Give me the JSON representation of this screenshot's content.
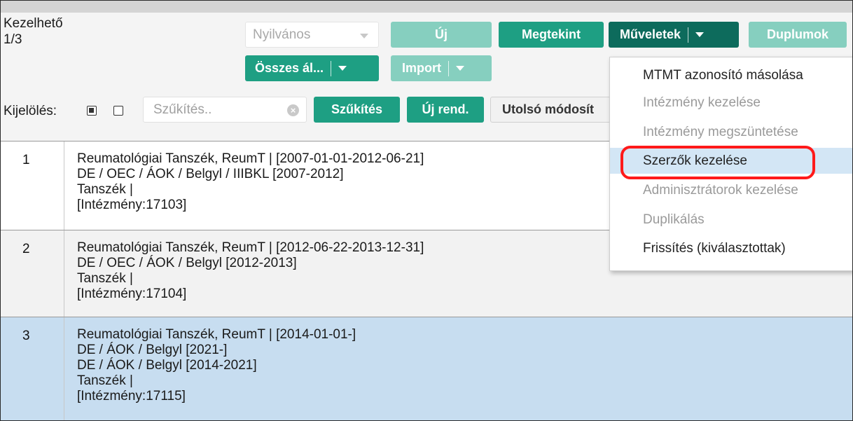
{
  "status": {
    "label": "Kezelhető",
    "count": "1/3"
  },
  "visibility_select": {
    "value": "Nyilvános"
  },
  "toolbar": {
    "new": "Új",
    "view": "Megtekint",
    "actions": "Műveletek",
    "duplicates": "Duplumok",
    "all_status": "Összes ál...",
    "import": "Import"
  },
  "selection": {
    "label": "Kijelölés:"
  },
  "filter": {
    "placeholder": "Szűkítés..",
    "button": "Szűkítés"
  },
  "new_order": "Új rend.",
  "sort": {
    "label": "Utolsó módosít"
  },
  "actions_menu": [
    {
      "label": "MTMT azonosító másolása"
    },
    {
      "label": "Intézmény kezelése"
    },
    {
      "label": "Intézmény megszüntetése"
    },
    {
      "label": "Szerzők kezelése"
    },
    {
      "label": "Adminisztrátorok kezelése"
    },
    {
      "label": "Duplikálás"
    },
    {
      "label": "Frissítés (kiválasztottak)"
    }
  ],
  "rows": [
    {
      "num": "1",
      "lines": [
        "Reumatológiai Tanszék, ReumT | [2007-01-01-2012-06-21]",
        "DE / OEC / ÁOK / Belgyl / IIIBKL [2007-2012]",
        "Tanszék |",
        "[Intézmény:17103]"
      ]
    },
    {
      "num": "2",
      "lines": [
        "Reumatológiai Tanszék, ReumT | [2012-06-22-2013-12-31]",
        "DE / OEC / ÁOK / Belgyl [2012-2013]",
        "Tanszék |",
        "[Intézmény:17104]"
      ]
    },
    {
      "num": "3",
      "lines": [
        "Reumatológiai Tanszék, ReumT | [2014-01-01-]",
        "DE / ÁOK / Belgyl [2021-]",
        "DE / ÁOK / Belgyl [2014-2021]",
        "Tanszék |",
        "[Intézmény:17115]"
      ]
    }
  ],
  "colors": {
    "accent": "#1e9f83",
    "accent_disabled": "#86cfbf",
    "accent_dark": "#0d6b5c",
    "selected_row": "#c7ddf0",
    "highlight": "#ff1a1a"
  }
}
